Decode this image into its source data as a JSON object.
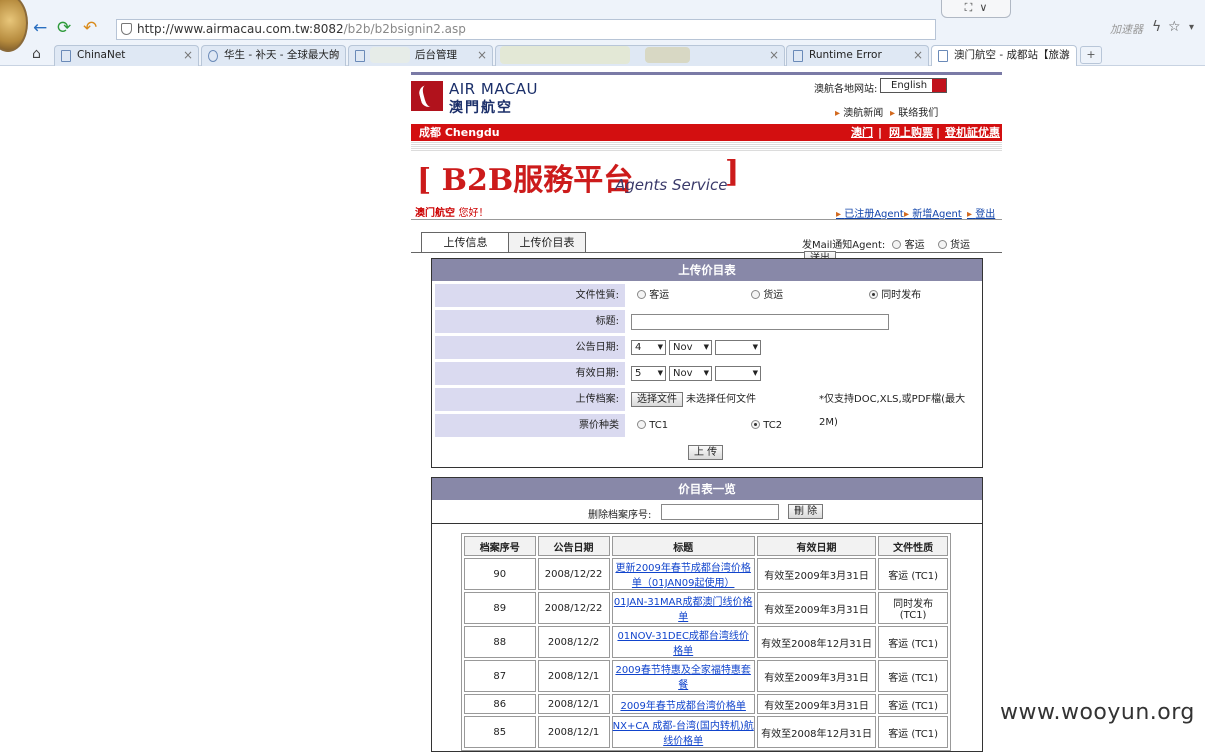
{
  "browser": {
    "url_host": "http://www.airmacau.com.tw:8082",
    "url_path": "/b2b/b2bsignin2.asp",
    "accelerator_label": "加速器",
    "tabs": [
      {
        "label": "ChinaNet"
      },
      {
        "label": "华生 - 补天 - 全球最大的"
      },
      {
        "label": "后台管理"
      },
      {
        "label": ""
      },
      {
        "label": "Runtime Error"
      },
      {
        "label": "澳门航空 - 成都站【旅游"
      }
    ]
  },
  "site": {
    "logo_en": "AIR MACAU",
    "logo_cn": "澳門航空",
    "sites_label": "澳航各地网站:",
    "lang_select": "English",
    "top_links": [
      "澳航新闻",
      "联络我们"
    ],
    "station": "成都 Chengdu",
    "red_links": [
      "澳门",
      "网上购票",
      "登机証优惠"
    ],
    "b2b_open": "[",
    "b2b_title": "B2B服務平台",
    "b2b_sub": "Agents Service",
    "b2b_close": "]",
    "hello_brand": "澳门航空",
    "hello_text": "您好！",
    "right_links": [
      "已注册Agent",
      "新增Agent",
      "登出"
    ]
  },
  "page_tabs": [
    "上传信息",
    "上传价目表"
  ],
  "mail": {
    "label": "发Mail通知Agent:",
    "opt1": "客运",
    "opt2": "货运",
    "button": "送出"
  },
  "upload": {
    "title": "上传价目表",
    "file_type_label": "文件性質:",
    "file_type_opts": [
      "客运",
      "货运",
      "同时发布"
    ],
    "subject_label": "标题:",
    "pub_date_label": "公告日期:",
    "pub_day": "4",
    "pub_month": "Nov",
    "pub_year": "",
    "valid_date_label": "有效日期:",
    "valid_day": "5",
    "valid_month": "Nov",
    "valid_year": "",
    "file_label": "上传档案:",
    "choose_file": "选择文件",
    "no_file": "未选择任何文件",
    "file_note": "*仅支持DOC,XLS,或PDF檔(最大2M)",
    "fare_label": "票价种类",
    "fare_opts": [
      "TC1",
      "TC2"
    ],
    "submit": "上 传"
  },
  "list": {
    "title": "价目表一览",
    "delete_label": "删除档案序号:",
    "delete_btn": "刪 除",
    "headers": [
      "档案序号",
      "公告日期",
      "标题",
      "有效日期",
      "文件性质"
    ],
    "rows": [
      {
        "id": "90",
        "date": "2008/12/22",
        "title": "更新2009年春节成都台湾价格单（01JAN09起使用）",
        "valid": "有效至2009年3月31日",
        "type": "客运 (TC1)"
      },
      {
        "id": "89",
        "date": "2008/12/22",
        "title": "01JAN-31MAR成都澳门线价格单",
        "valid": "有效至2009年3月31日",
        "type": "同时发布 (TC1)"
      },
      {
        "id": "88",
        "date": "2008/12/2",
        "title": "01NOV-31DEC成都台湾线价格单",
        "valid": "有效至2008年12月31日",
        "type": "客运 (TC1)"
      },
      {
        "id": "87",
        "date": "2008/12/1",
        "title": "2009春节特惠及全家福特惠套餐",
        "valid": "有效至2009年3月31日",
        "type": "客运 (TC1)"
      },
      {
        "id": "86",
        "date": "2008/12/1",
        "title": "2009年春节成都台湾价格单",
        "valid": "有效至2009年3月31日",
        "type": "客运 (TC1)"
      },
      {
        "id": "85",
        "date": "2008/12/1",
        "title": "NX+CA 成都-台湾(国内转机)航线价格单",
        "valid": "有效至2008年12月31日",
        "type": "客运 (TC1)"
      }
    ]
  },
  "watermark": "www.wooyun.org"
}
